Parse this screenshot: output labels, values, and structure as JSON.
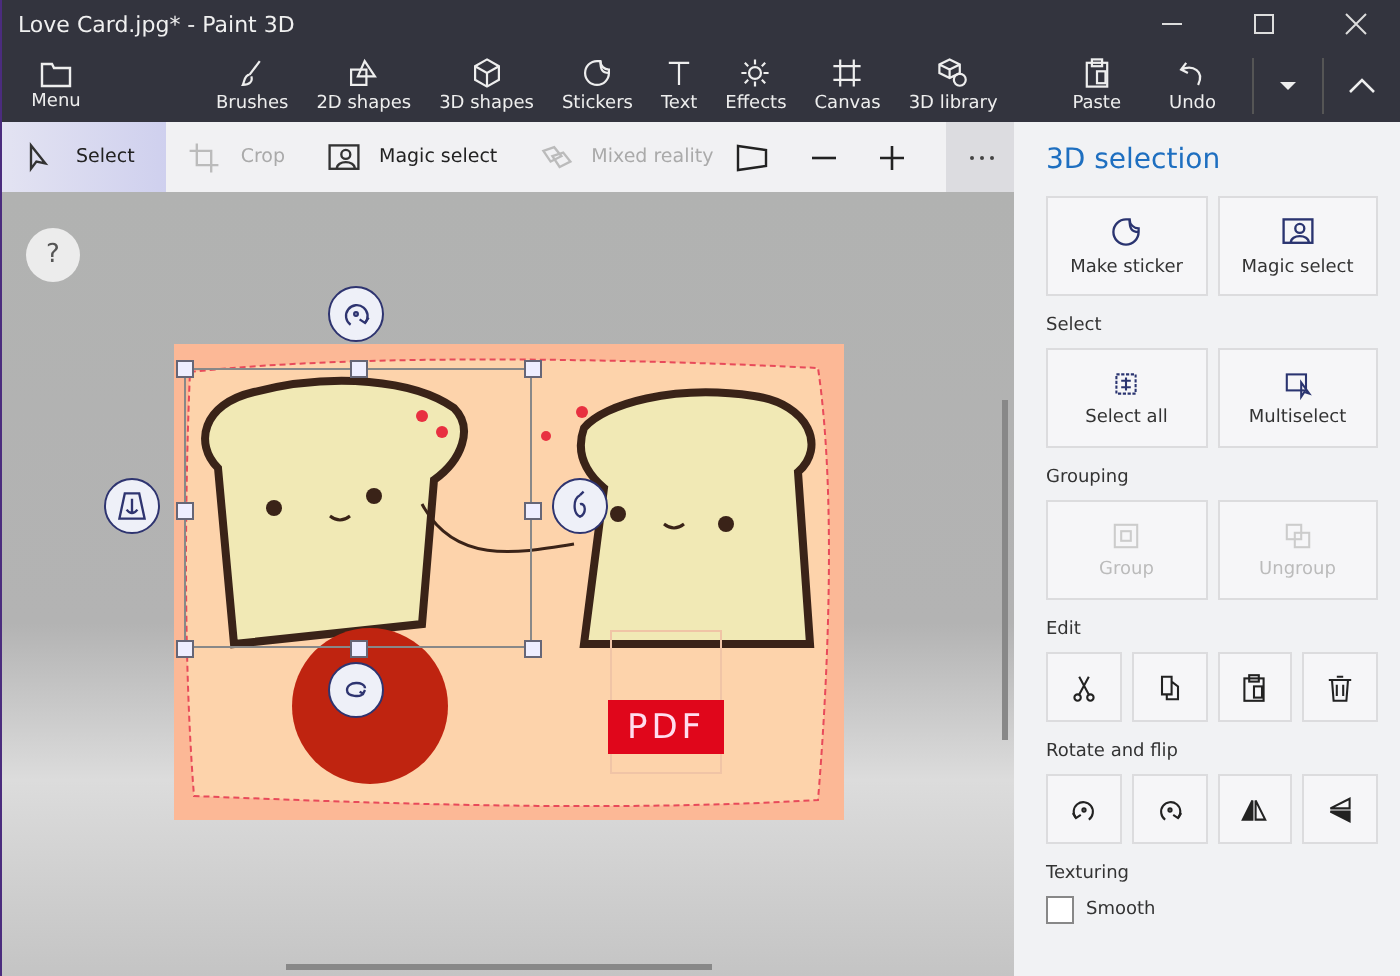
{
  "window": {
    "title": "Love Card.jpg* - Paint 3D"
  },
  "ribbon": {
    "menu": {
      "label": "Menu"
    },
    "tools": [
      {
        "label": "Brushes",
        "kind": "brush"
      },
      {
        "label": "2D shapes",
        "kind": "shapes2d"
      },
      {
        "label": "3D shapes",
        "kind": "cube"
      },
      {
        "label": "Stickers",
        "kind": "sticker"
      },
      {
        "label": "Text",
        "kind": "text"
      },
      {
        "label": "Effects",
        "kind": "sun"
      },
      {
        "label": "Canvas",
        "kind": "canvas"
      },
      {
        "label": "3D library",
        "kind": "library"
      }
    ],
    "actions": [
      {
        "label": "Paste",
        "kind": "paste"
      },
      {
        "label": "Undo",
        "kind": "undo"
      }
    ]
  },
  "toolbar": {
    "items": [
      {
        "label": "Select",
        "kind": "cursor",
        "selected": true,
        "disabled": false
      },
      {
        "label": "Crop",
        "kind": "crop",
        "selected": false,
        "disabled": true
      },
      {
        "label": "Magic select",
        "kind": "magic",
        "selected": false,
        "disabled": false
      },
      {
        "label": "Mixed reality",
        "kind": "mixed",
        "selected": false,
        "disabled": true
      }
    ]
  },
  "panel": {
    "title": "3D selection",
    "top_buttons": [
      {
        "label": "Make sticker",
        "kind": "sticker",
        "disabled": false
      },
      {
        "label": "Magic select",
        "kind": "magic",
        "disabled": false
      }
    ],
    "sections": [
      {
        "heading": "Select",
        "kind": "buttons",
        "buttons": [
          {
            "label": "Select all",
            "kind": "selectall",
            "disabled": false
          },
          {
            "label": "Multiselect",
            "kind": "multiselect",
            "disabled": false
          }
        ]
      },
      {
        "heading": "Grouping",
        "kind": "buttons",
        "buttons": [
          {
            "label": "Group",
            "kind": "group",
            "disabled": true
          },
          {
            "label": "Ungroup",
            "kind": "ungroup",
            "disabled": true
          }
        ]
      },
      {
        "heading": "Edit",
        "kind": "icons",
        "buttons": [
          {
            "kind": "cut"
          },
          {
            "kind": "copy"
          },
          {
            "kind": "paste"
          },
          {
            "kind": "delete"
          }
        ]
      },
      {
        "heading": "Rotate and flip",
        "kind": "icons",
        "buttons": [
          {
            "kind": "rotleft"
          },
          {
            "kind": "rotright"
          },
          {
            "kind": "fliph"
          },
          {
            "kind": "flipv"
          }
        ]
      },
      {
        "heading": "Texturing",
        "kind": "checkbox",
        "checkbox": {
          "label": "Smooth",
          "checked": false
        }
      }
    ]
  },
  "canvas": {
    "help": "?",
    "pdf_label": "PDF"
  }
}
